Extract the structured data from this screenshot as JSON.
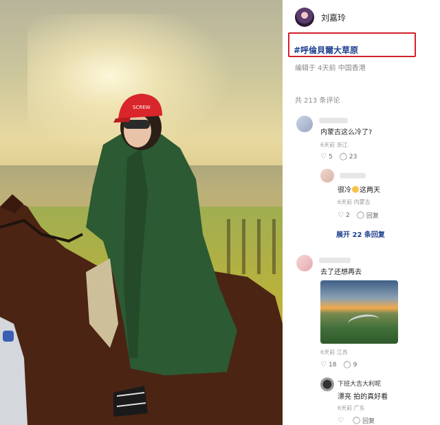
{
  "author": {
    "name": "刘嘉玲"
  },
  "post": {
    "hashtag": "#呼倫貝爾大草原",
    "meta": "编辑于 4天前 中国香港"
  },
  "comments_count": "共 213 条评论",
  "comments": [
    {
      "text": "内蒙古这么冷了?",
      "meta": "6天前 浙江",
      "likes": "5",
      "replies": "23"
    },
    {
      "text_prefix": "很冷",
      "text_suffix": "这两天",
      "meta": "6天前 内蒙古",
      "likes": "2",
      "reply_label": "回复"
    },
    {
      "expand_label": "展开 22 条回复"
    },
    {
      "text": "去了还想再去",
      "meta": "6天前 江苏",
      "likes": "18",
      "replies": "9"
    },
    {
      "name": "下班大吉大利呢",
      "text": "漂亮 拍的真好看",
      "meta": "6天前 广东",
      "reply_label": "回复"
    }
  ],
  "icons": {
    "like": "heart-outline-icon",
    "reply": "speech-bubble-icon"
  }
}
